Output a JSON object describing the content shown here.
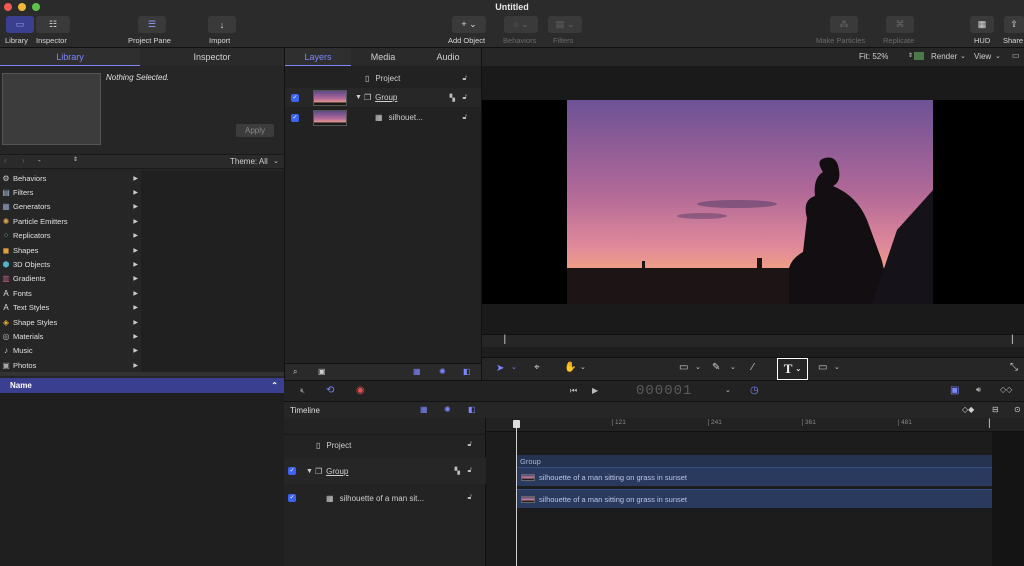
{
  "window": {
    "title": "Untitled"
  },
  "toolbar": {
    "library_label": "Library",
    "inspector_label": "Inspector",
    "project_pane_label": "Project Pane",
    "import_label": "Import",
    "add_object_label": "Add Object",
    "behaviors_label": "Behaviors",
    "filters_label": "Filters",
    "make_particles_label": "Make Particles",
    "replicate_label": "Replicate",
    "hud_label": "HUD",
    "share_label": "Share"
  },
  "left_tabs": {
    "library": "Library",
    "inspector": "Inspector"
  },
  "library": {
    "preview_text": "Nothing Selected.",
    "apply_label": "Apply",
    "theme_label": "Theme: All",
    "path_value": "-",
    "categories": [
      {
        "label": "Behaviors",
        "icon": "gear-icon",
        "color": "#cccccc"
      },
      {
        "label": "Filters",
        "icon": "filters-icon",
        "color": "#9fb8d8"
      },
      {
        "label": "Generators",
        "icon": "generators-icon",
        "color": "#8fa0c0"
      },
      {
        "label": "Particle Emitters",
        "icon": "particle-emitters-icon",
        "color": "#d9a24a"
      },
      {
        "label": "Replicators",
        "icon": "replicators-icon",
        "color": "#5fbf7a"
      },
      {
        "label": "Shapes",
        "icon": "shapes-icon",
        "color": "#e0a040"
      },
      {
        "label": "3D Objects",
        "icon": "3d-objects-icon",
        "color": "#4fb3c8"
      },
      {
        "label": "Gradients",
        "icon": "gradients-icon",
        "color": "#c05a8a"
      },
      {
        "label": "Fonts",
        "icon": "fonts-icon",
        "color": "#dddddd"
      },
      {
        "label": "Text Styles",
        "icon": "text-styles-icon",
        "color": "#dddddd"
      },
      {
        "label": "Shape Styles",
        "icon": "shape-styles-icon",
        "color": "#e0b030"
      },
      {
        "label": "Materials",
        "icon": "materials-icon",
        "color": "#bbbbbb"
      },
      {
        "label": "Music",
        "icon": "music-icon",
        "color": "#cccccc"
      },
      {
        "label": "Photos",
        "icon": "photos-icon",
        "color": "#aaaaaa"
      }
    ],
    "name_header": "Name"
  },
  "project_tabs": {
    "layers": "Layers",
    "media": "Media",
    "audio": "Audio"
  },
  "layers": {
    "project": "Project",
    "group": "Group",
    "clip": "silhouet..."
  },
  "canvas": {
    "fit_label": "Fit: 52%",
    "render_label": "Render",
    "view_label": "View"
  },
  "transport": {
    "timecode": "000001"
  },
  "timeline": {
    "title": "Timeline",
    "ruler": [
      "121",
      "241",
      "361",
      "481"
    ],
    "layers": {
      "project": "Project",
      "group": "Group",
      "clip": "silhouette of a man sit..."
    },
    "track_group": "Group",
    "clip_label": "silhouette of a man sitting on grass in sunset"
  },
  "colors": {
    "accent": "#3d63f2",
    "selection": "#3b3f8f",
    "clip_bg": "#2a3a5e"
  }
}
